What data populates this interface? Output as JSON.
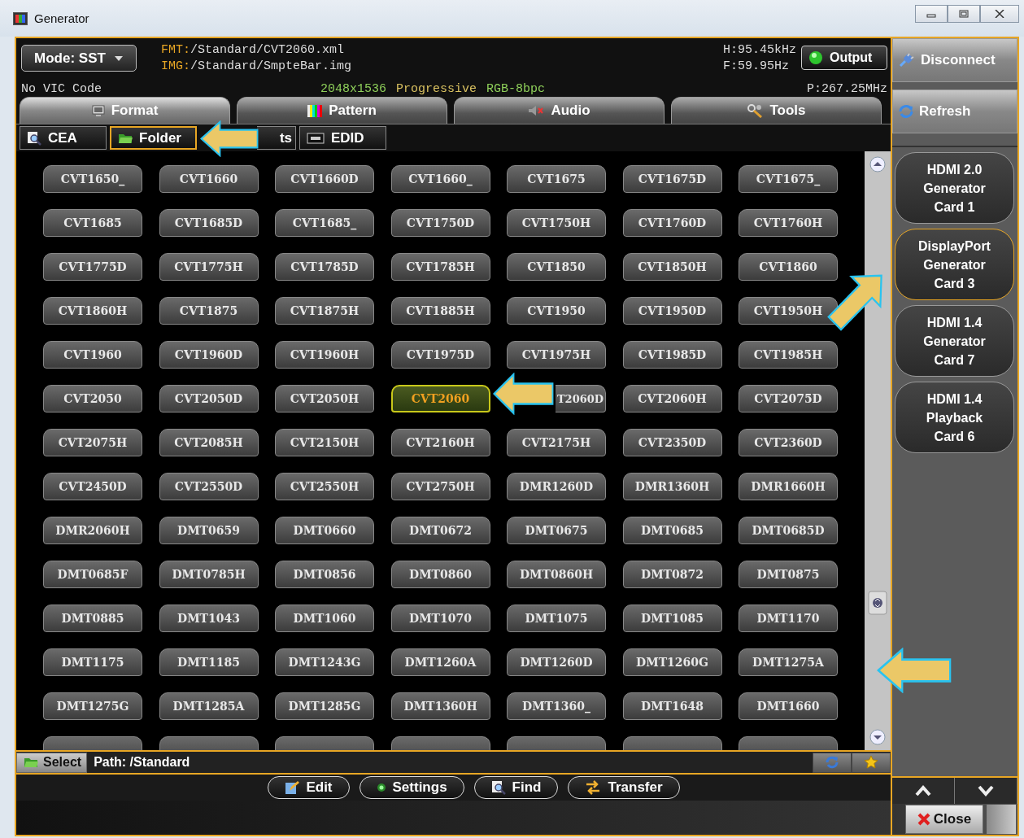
{
  "window": {
    "title": "Generator"
  },
  "header": {
    "mode": "Mode: SST",
    "fmt_label": "FMT:",
    "fmt_path": "/Standard/CVT2060.xml",
    "img_label": "IMG:",
    "img_path": "/Standard/SmpteBar.img",
    "h_freq": "H:95.45kHz",
    "v_freq": "F:59.95Hz",
    "pixel_clock": "P:267.25MHz",
    "vic": "No VIC Code",
    "format_info": [
      {
        "text": "2048x1536",
        "color": "#8fd05a"
      },
      {
        "text": "Progressive",
        "color": "#d8c060"
      },
      {
        "text": "RGB-8bpc",
        "color": "#8fd05a"
      }
    ],
    "output": {
      "label": "Output",
      "on": true
    }
  },
  "tabs": [
    {
      "label": "Format",
      "selected": true
    },
    {
      "label": "Pattern",
      "selected": false
    },
    {
      "label": "Audio",
      "selected": false
    },
    {
      "label": "Tools",
      "selected": false
    }
  ],
  "subtabs": [
    {
      "label": "CEA",
      "selected": false
    },
    {
      "label": "Folder",
      "selected": true
    },
    {
      "label": "ts",
      "kind": "covered",
      "selected": false
    },
    {
      "label": "EDID",
      "selected": false
    }
  ],
  "formats": [
    {
      "label": "CVT1650_",
      "selected": false
    },
    {
      "label": "CVT1660",
      "selected": false
    },
    {
      "label": "CVT1660D",
      "selected": false
    },
    {
      "label": "CVT1660_",
      "selected": false
    },
    {
      "label": "CVT1675",
      "selected": false
    },
    {
      "label": "CVT1675D",
      "selected": false
    },
    {
      "label": "CVT1675_",
      "selected": false
    },
    {
      "label": "CVT1685",
      "selected": false
    },
    {
      "label": "CVT1685D",
      "selected": false
    },
    {
      "label": "CVT1685_",
      "selected": false
    },
    {
      "label": "CVT1750D",
      "selected": false
    },
    {
      "label": "CVT1750H",
      "selected": false
    },
    {
      "label": "CVT1760D",
      "selected": false
    },
    {
      "label": "CVT1760H",
      "selected": false
    },
    {
      "label": "CVT1775D",
      "selected": false
    },
    {
      "label": "CVT1775H",
      "selected": false
    },
    {
      "label": "CVT1785D",
      "selected": false
    },
    {
      "label": "CVT1785H",
      "selected": false
    },
    {
      "label": "CVT1850",
      "selected": false
    },
    {
      "label": "CVT1850H",
      "selected": false
    },
    {
      "label": "CVT1860",
      "selected": false
    },
    {
      "label": "CVT1860H",
      "selected": false
    },
    {
      "label": "CVT1875",
      "selected": false
    },
    {
      "label": "CVT1875H",
      "selected": false
    },
    {
      "label": "CVT1885H",
      "selected": false
    },
    {
      "label": "CVT1950",
      "selected": false
    },
    {
      "label": "CVT1950D",
      "selected": false
    },
    {
      "label": "CVT1950H",
      "selected": false
    },
    {
      "label": "CVT1960",
      "selected": false
    },
    {
      "label": "CVT1960D",
      "selected": false
    },
    {
      "label": "CVT1960H",
      "selected": false
    },
    {
      "label": "CVT1975D",
      "selected": false
    },
    {
      "label": "CVT1975H",
      "selected": false
    },
    {
      "label": "CVT1985D",
      "selected": false
    },
    {
      "label": "CVT1985H",
      "selected": false
    },
    {
      "label": "CVT2050",
      "selected": false
    },
    {
      "label": "CVT2050D",
      "selected": false
    },
    {
      "label": "CVT2050H",
      "selected": false
    },
    {
      "label": "CVT2060",
      "selected": true
    },
    {
      "label": "T2060D",
      "kind": "covered",
      "selected": false
    },
    {
      "label": "CVT2060H",
      "selected": false
    },
    {
      "label": "CVT2075D",
      "selected": false
    },
    {
      "label": "CVT2075H",
      "selected": false
    },
    {
      "label": "CVT2085H",
      "selected": false
    },
    {
      "label": "CVT2150H",
      "selected": false
    },
    {
      "label": "CVT2160H",
      "selected": false
    },
    {
      "label": "CVT2175H",
      "selected": false
    },
    {
      "label": "CVT2350D",
      "selected": false
    },
    {
      "label": "CVT2360D",
      "selected": false
    },
    {
      "label": "CVT2450D",
      "selected": false
    },
    {
      "label": "CVT2550D",
      "selected": false
    },
    {
      "label": "CVT2550H",
      "selected": false
    },
    {
      "label": "CVT2750H",
      "selected": false
    },
    {
      "label": "DMR1260D",
      "selected": false
    },
    {
      "label": "DMR1360H",
      "selected": false
    },
    {
      "label": "DMR1660H",
      "selected": false
    },
    {
      "label": "DMR2060H",
      "selected": false
    },
    {
      "label": "DMT0659",
      "selected": false
    },
    {
      "label": "DMT0660",
      "selected": false
    },
    {
      "label": "DMT0672",
      "selected": false
    },
    {
      "label": "DMT0675",
      "selected": false
    },
    {
      "label": "DMT0685",
      "selected": false
    },
    {
      "label": "DMT0685D",
      "selected": false
    },
    {
      "label": "DMT0685F",
      "selected": false
    },
    {
      "label": "DMT0785H",
      "selected": false
    },
    {
      "label": "DMT0856",
      "selected": false
    },
    {
      "label": "DMT0860",
      "selected": false
    },
    {
      "label": "DMT0860H",
      "selected": false
    },
    {
      "label": "DMT0872",
      "selected": false
    },
    {
      "label": "DMT0875",
      "selected": false
    },
    {
      "label": "DMT0885",
      "selected": false
    },
    {
      "label": "DMT1043",
      "selected": false
    },
    {
      "label": "DMT1060",
      "selected": false
    },
    {
      "label": "DMT1070",
      "selected": false
    },
    {
      "label": "DMT1075",
      "selected": false
    },
    {
      "label": "DMT1085",
      "selected": false
    },
    {
      "label": "DMT1170",
      "selected": false
    },
    {
      "label": "DMT1175",
      "selected": false
    },
    {
      "label": "DMT1185",
      "selected": false
    },
    {
      "label": "DMT1243G",
      "selected": false
    },
    {
      "label": "DMT1260A",
      "selected": false
    },
    {
      "label": "DMT1260D",
      "selected": false
    },
    {
      "label": "DMT1260G",
      "selected": false
    },
    {
      "label": "DMT1275A",
      "selected": false
    },
    {
      "label": "DMT1275G",
      "selected": false
    },
    {
      "label": "DMT1285A",
      "selected": false
    },
    {
      "label": "DMT1285G",
      "selected": false
    },
    {
      "label": "DMT1360H",
      "selected": false
    },
    {
      "label": "DMT1360_",
      "selected": false
    },
    {
      "label": "DMT1648",
      "selected": false
    },
    {
      "label": "DMT1660",
      "selected": false
    },
    {
      "kind": "cut",
      "selected": false
    },
    {
      "kind": "cut",
      "selected": false
    },
    {
      "kind": "cut",
      "selected": false
    },
    {
      "kind": "cut",
      "selected": false
    },
    {
      "kind": "cut",
      "selected": false
    },
    {
      "kind": "cut",
      "selected": false
    },
    {
      "kind": "cut",
      "selected": false
    }
  ],
  "path_bar": {
    "select": "Select",
    "path": "Path: /Standard"
  },
  "actions": [
    {
      "label": "Edit"
    },
    {
      "label": "Settings"
    },
    {
      "label": "Find"
    },
    {
      "label": "Transfer"
    }
  ],
  "side": {
    "disconnect": "Disconnect",
    "refresh": "Refresh",
    "cards": [
      {
        "lines": [
          "HDMI 2.0",
          "Generator",
          "Card 1"
        ],
        "selected": false
      },
      {
        "lines": [
          "DisplayPort",
          "Generator",
          "Card 3"
        ],
        "selected": true
      },
      {
        "lines": [
          "HDMI 1.4",
          "Generator",
          "Card 7"
        ],
        "selected": false
      },
      {
        "lines": [
          "HDMI 1.4",
          "Playback",
          "Card 6"
        ],
        "selected": false
      }
    ],
    "close": "Close"
  }
}
